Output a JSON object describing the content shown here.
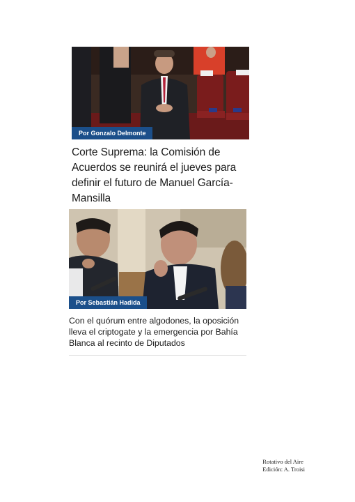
{
  "articles": [
    {
      "author": "Por Gonzalo Delmonte",
      "headline": "Corte Suprema: la Comisión de Acuerdos se reunirá el jueves para definir el futuro de Manuel García-Mansilla"
    },
    {
      "author": "Por Sebastián Hadida",
      "headline": "Con el quórum entre algodones, la oposición lleva el criptogate y la emergencia por Bahía Blanca al recinto de Diputados"
    }
  ],
  "footer": {
    "line1": "Rotativo del Aire",
    "line2": "Edición: A. Troisi"
  },
  "colors": {
    "author_tag_bg": "#1b4f8a",
    "text": "#1a1a1a"
  }
}
